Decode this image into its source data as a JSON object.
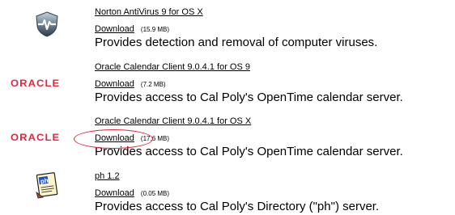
{
  "entries": [
    {
      "icon": "norton-shield-icon",
      "title": "Norton AntiVirus 9 for OS X",
      "download_label": "Download",
      "size": "(15.9 MB)",
      "description": "Provides detection and removal of computer viruses."
    },
    {
      "icon": "oracle-logo",
      "logo_text": "ORACLE",
      "title": "Oracle Calendar Client 9.0.4.1 for OS 9",
      "download_label": "Download",
      "size": "(7.2 MB)",
      "description": "Provides access to Cal Poly's OpenTime calendar server."
    },
    {
      "icon": "oracle-logo",
      "logo_text": "ORACLE",
      "title": "Oracle Calendar Client 9.0.4.1 for OS X",
      "download_label": "Download",
      "size": "(17.6 MB)",
      "description": "Provides access to Cal Poly's OpenTime calendar server.",
      "highlighted": true
    },
    {
      "icon": "ph-address-card-icon",
      "title": "ph 1.2",
      "download_label": "Download",
      "size": "(0.05 MB)",
      "description": "Provides access to Cal Poly's Directory (\"ph\") server."
    }
  ],
  "colors": {
    "oracle_red": "#e0283c",
    "highlight_circle": "#e0283c",
    "text": "#000000"
  }
}
